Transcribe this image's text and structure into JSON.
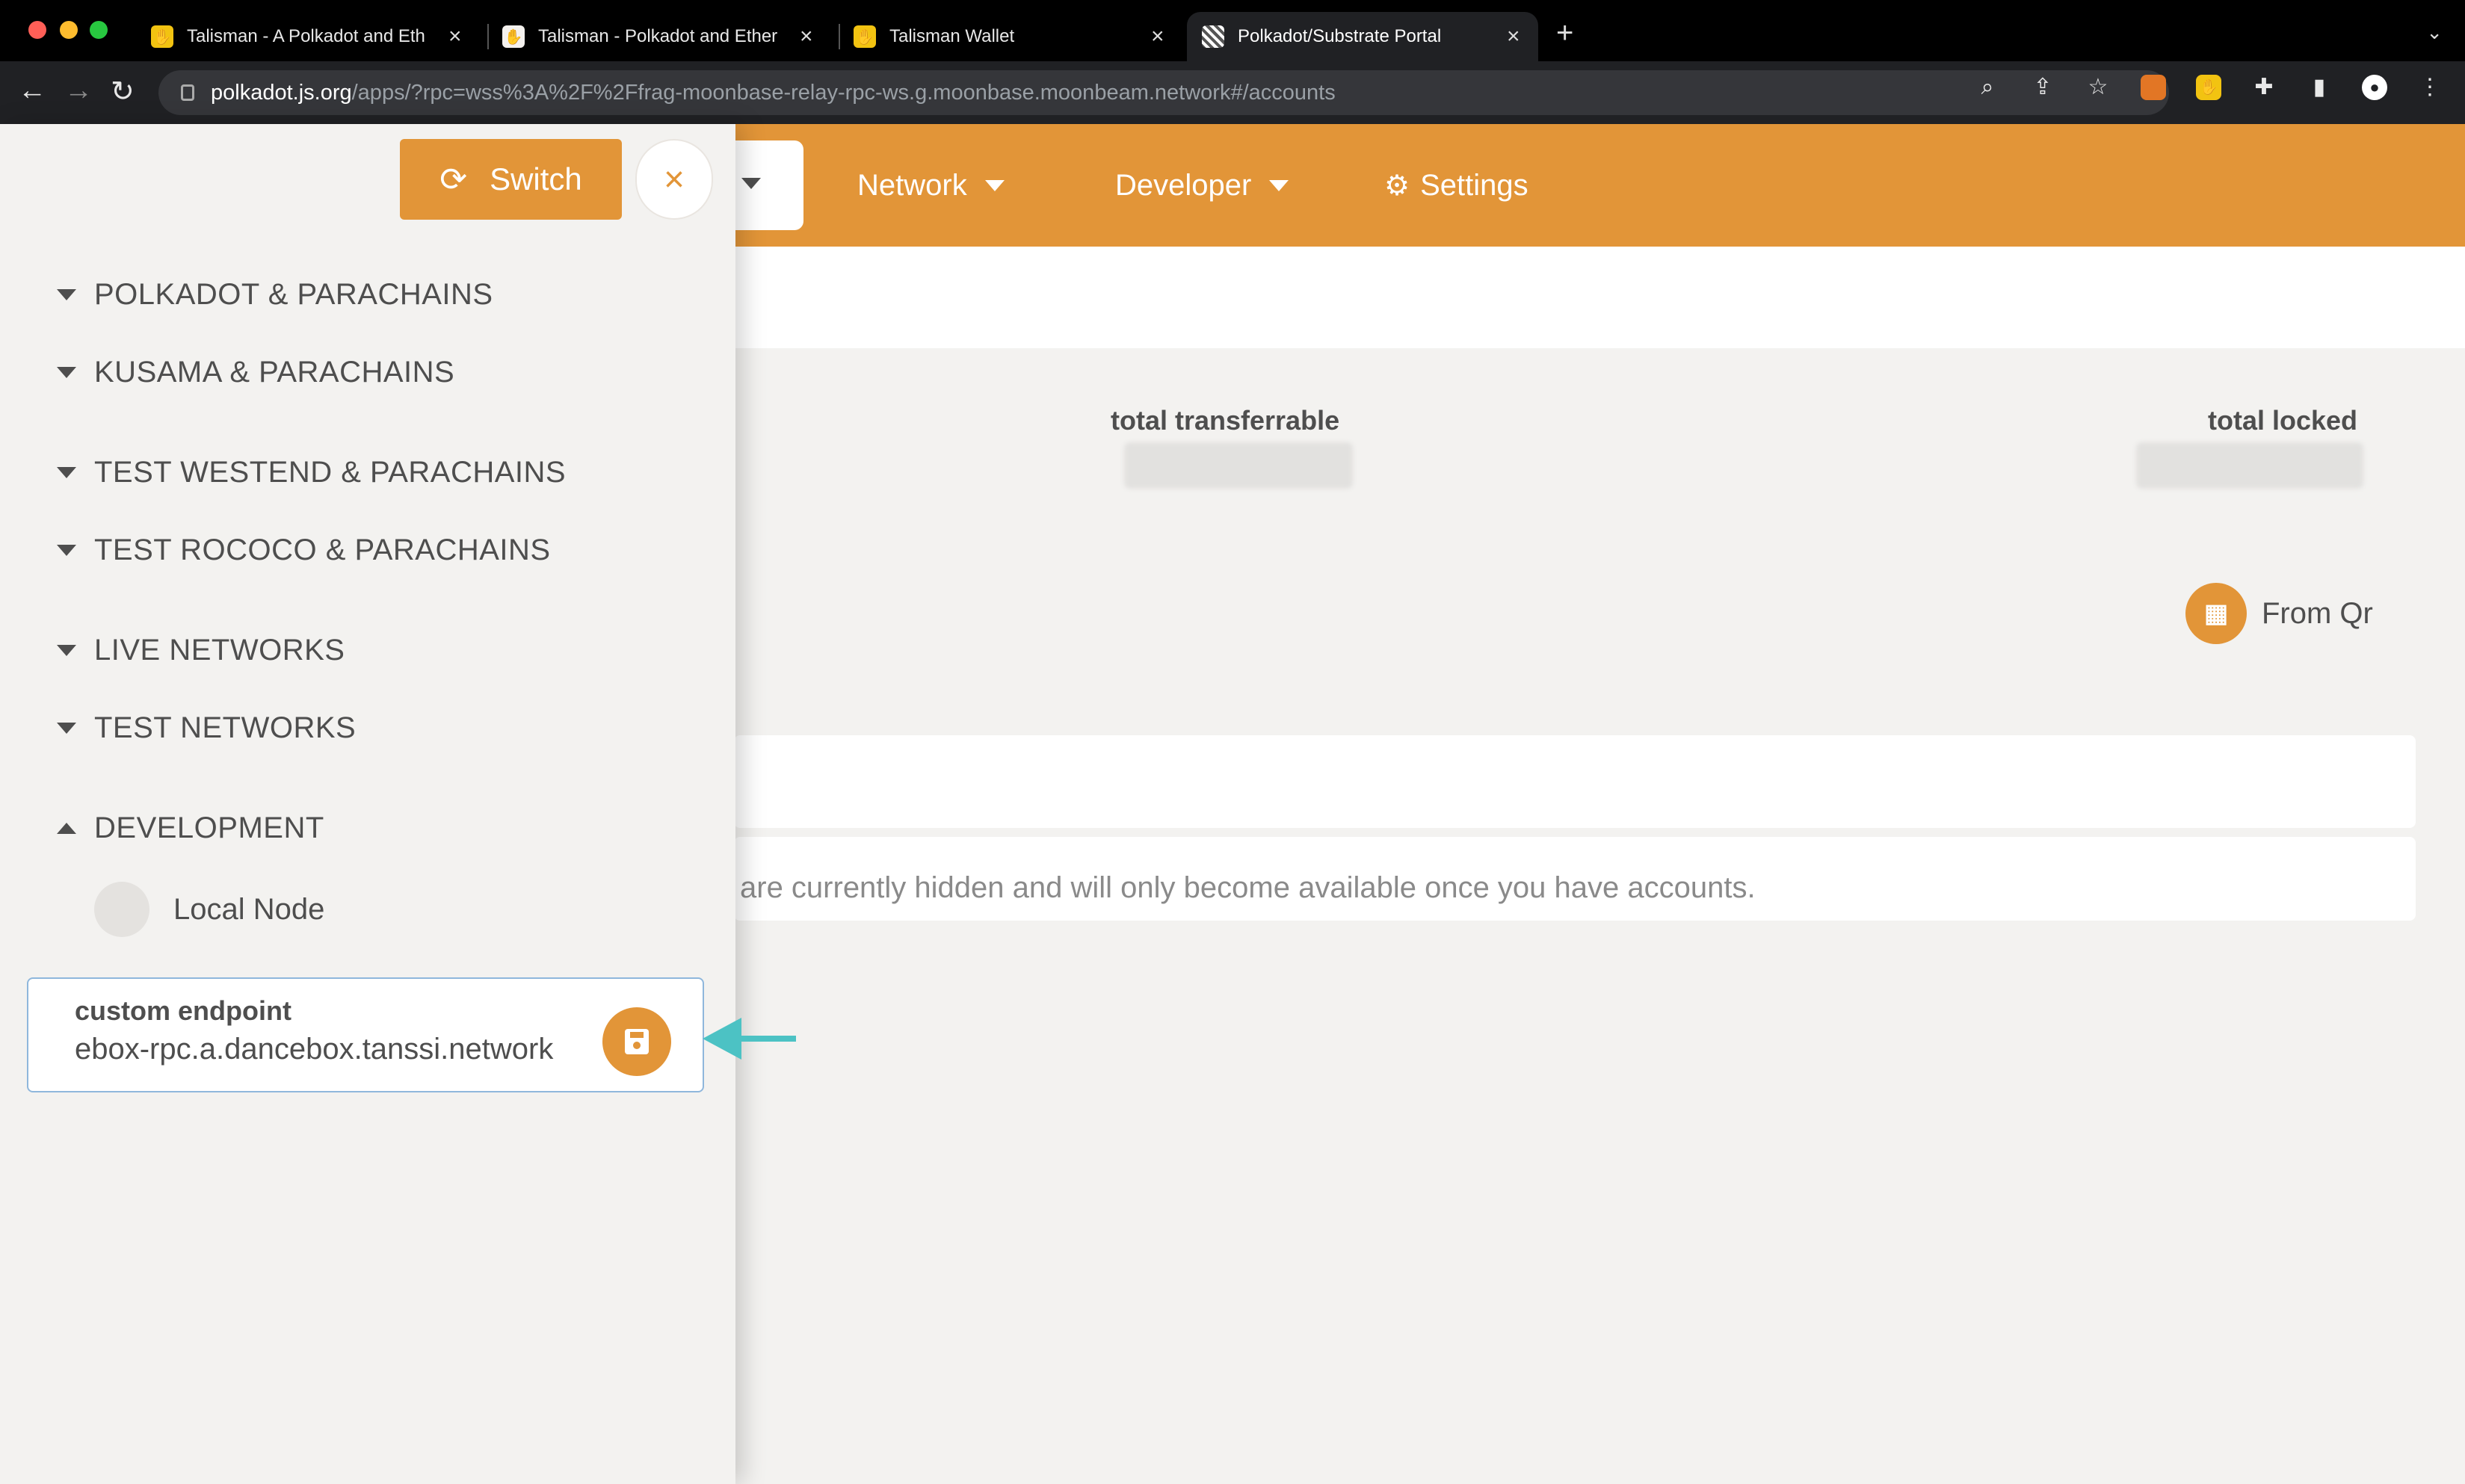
{
  "browser": {
    "tabs": [
      {
        "title": "Talisman - A Polkadot and Eth",
        "active": false
      },
      {
        "title": "Talisman - Polkadot and Ether",
        "active": false
      },
      {
        "title": "Talisman Wallet",
        "active": false
      },
      {
        "title": "Polkadot/Substrate Portal",
        "active": true
      }
    ],
    "new_tab": "+",
    "address": {
      "host": "polkadot.js.org",
      "path": "/apps/?rpc=wss%3A%2F%2Ffrag-moonbase-relay-rpc-ws.g.moonbase.moonbeam.network#/accounts"
    },
    "icons": [
      "zoom-icon",
      "share-icon",
      "star-icon",
      "metamask-icon",
      "talisman-icon",
      "extensions-icon",
      "sidepanel-icon",
      "profile-icon",
      "menu-icon"
    ]
  },
  "nav": {
    "network": "Network",
    "developer": "Developer",
    "settings": "Settings"
  },
  "summary": {
    "transferrable_label": "total transferrable",
    "locked_label": "total locked"
  },
  "from_qr": "From Qr",
  "hint_text": "are currently hidden and will only become available once you have accounts.",
  "drawer": {
    "switch_label": "Switch",
    "close_label": "×",
    "groups": [
      {
        "label": "POLKADOT & PARACHAINS",
        "expanded": false
      },
      {
        "label": "KUSAMA & PARACHAINS",
        "expanded": false
      },
      {
        "label": "TEST WESTEND & PARACHAINS",
        "expanded": false
      },
      {
        "label": "TEST ROCOCO & PARACHAINS",
        "expanded": false
      },
      {
        "label": "LIVE NETWORKS",
        "expanded": false
      },
      {
        "label": "TEST NETWORKS",
        "expanded": false
      },
      {
        "label": "DEVELOPMENT",
        "expanded": true
      }
    ],
    "local_node": "Local Node",
    "custom_endpoint": {
      "label": "custom endpoint",
      "value": "ebox-rpc.a.dancebox.tanssi.network"
    }
  },
  "colors": {
    "accent": "#e29538",
    "annotation_arrow": "#4cc2c4",
    "text": "#4e4e4e",
    "background": "#f3f2f0"
  }
}
